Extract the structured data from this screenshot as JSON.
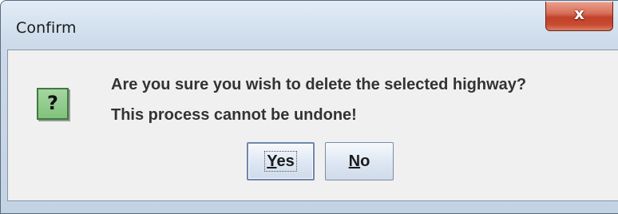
{
  "window": {
    "title": "Confirm",
    "close_glyph": "x"
  },
  "dialog": {
    "icon": "question-icon",
    "icon_glyph": "?",
    "message_line1": "Are you sure you wish to delete the selected highway?",
    "message_line2": "This process cannot be undone!"
  },
  "buttons": {
    "yes": {
      "mnemonic": "Y",
      "rest": "es",
      "focused": true
    },
    "no": {
      "mnemonic": "N",
      "rest": "o",
      "focused": false
    }
  },
  "colors": {
    "titlebar": "#d5e2ef",
    "close_button": "#c84a31",
    "content_bg": "#f0f0f0",
    "icon_green": "#80c27b",
    "text": "#333333"
  }
}
